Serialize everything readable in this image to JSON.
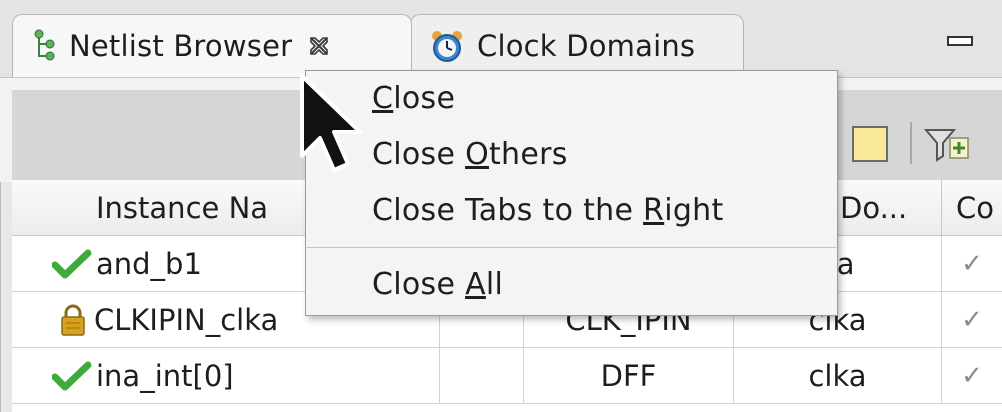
{
  "tabs": [
    {
      "label": "Netlist Browser",
      "active": true,
      "icon": "netlist-tree-icon"
    },
    {
      "label": "Clock Domains",
      "active": false,
      "icon": "alarm-clock-icon"
    }
  ],
  "table": {
    "columns": [
      "Instance Na",
      "",
      "",
      "Do...",
      "Co"
    ],
    "rows": [
      {
        "status_icon": "check-icon",
        "name": "and_b1",
        "type": "",
        "domain": "ka",
        "check": "✓"
      },
      {
        "status_icon": "lock-icon",
        "name": "CLKIPIN_clka",
        "type": "CLK_IPIN",
        "domain": "clka",
        "check": "✓"
      },
      {
        "status_icon": "check-icon",
        "name": "ina_int[0]",
        "type": "DFF",
        "domain": "clka",
        "check": "✓"
      }
    ]
  },
  "context_menu": {
    "items": [
      {
        "pre": "",
        "mnemonic": "C",
        "post": "lose"
      },
      {
        "pre": "Close ",
        "mnemonic": "O",
        "post": "thers"
      },
      {
        "pre": "Close Tabs to the ",
        "mnemonic": "R",
        "post": "ight"
      },
      {
        "pre": "Close ",
        "mnemonic": "A",
        "post": "ll"
      }
    ]
  },
  "colors": {
    "check_green": "#3cab3c",
    "lock_gold": "#d9a21e",
    "highlight_button": "#fbe99a"
  }
}
